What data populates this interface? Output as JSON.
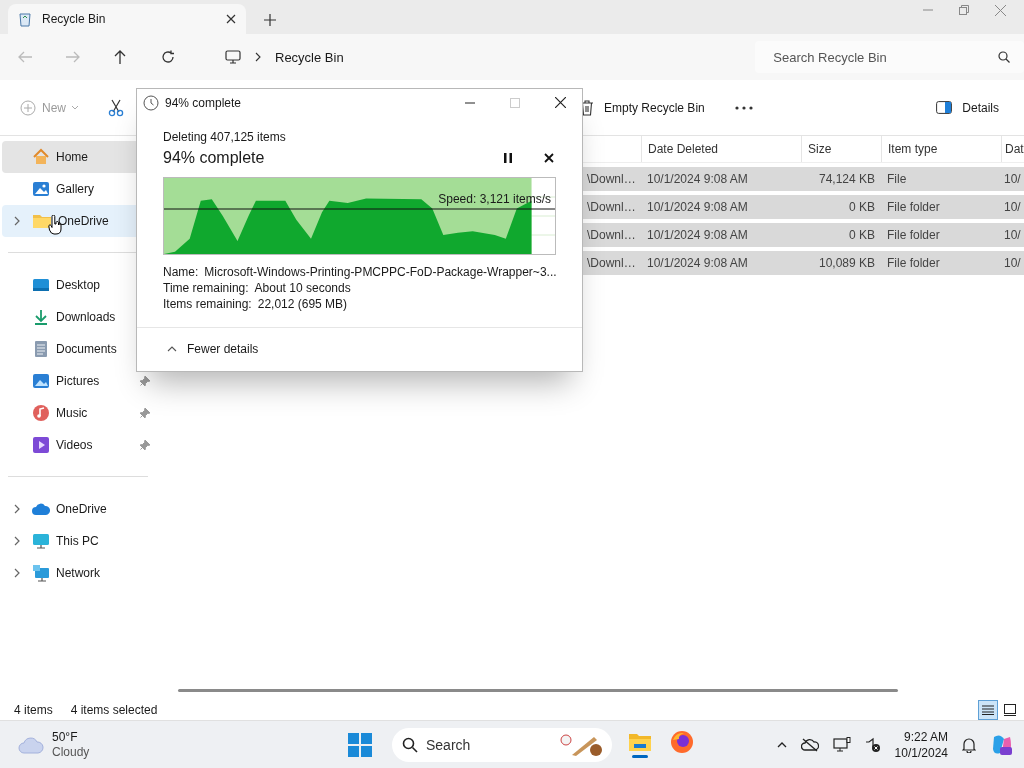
{
  "window": {
    "tab_title": "Recycle Bin"
  },
  "address": {
    "crumbs": [
      "Recycle Bin"
    ],
    "search": {
      "placeholder": "Search Recycle Bin"
    }
  },
  "toolbar": {
    "new": {
      "label": "New",
      "disabled": true
    },
    "empty_label": "Empty Recycle Bin",
    "details_label": "Details"
  },
  "sidebar": {
    "quick": [
      {
        "label": "Home",
        "selected": true,
        "hover": false,
        "expandable": false
      },
      {
        "label": "Gallery",
        "selected": false,
        "hover": false,
        "expandable": false
      },
      {
        "label": "OneDrive",
        "selected": false,
        "hover": true,
        "expandable": true
      }
    ],
    "pinned": [
      {
        "label": "Desktop"
      },
      {
        "label": "Downloads"
      },
      {
        "label": "Documents"
      },
      {
        "label": "Pictures",
        "pinned": true
      },
      {
        "label": "Music",
        "pinned": true
      },
      {
        "label": "Videos",
        "pinned": true
      }
    ],
    "tree": [
      {
        "label": "OneDrive"
      },
      {
        "label": "This PC"
      },
      {
        "label": "Network"
      }
    ]
  },
  "table": {
    "columns": [
      "",
      "Date Deleted",
      "Size",
      "Item type",
      "Dat"
    ],
    "rows": [
      {
        "selected": true,
        "cells": [
          "\\Downl…",
          "10/1/2024 9:08 AM",
          "74,124 KB",
          "File",
          "10/"
        ]
      },
      {
        "selected": true,
        "cells": [
          "\\Downl…",
          "10/1/2024 9:08 AM",
          "0 KB",
          "File folder",
          "10/"
        ]
      },
      {
        "selected": true,
        "cells": [
          "\\Downl…",
          "10/1/2024 9:08 AM",
          "0 KB",
          "File folder",
          "10/"
        ]
      },
      {
        "selected": true,
        "cells": [
          "\\Downl…",
          "10/1/2024 9:08 AM",
          "10,089 KB",
          "File folder",
          "10/"
        ]
      }
    ]
  },
  "status_bar": {
    "count": "4 items",
    "selection": "4 items selected",
    "views": [
      {
        "selected": true
      },
      {
        "selected": false
      }
    ]
  },
  "dialog": {
    "title": "94% complete",
    "summary": "Deleting 407,125 items",
    "heading": "94% complete",
    "graph": {
      "level": 0.94,
      "speed": "Speed: 3,121 items/s"
    },
    "details": [
      {
        "label": "Name:",
        "value": "Microsoft-Windows-Printing-PMCPPC-FoD-Package-Wrapper~3..."
      },
      {
        "label": "Time remaining:",
        "value": "About 10 seconds"
      },
      {
        "label": "Items remaining:",
        "value": "22,012 (695 MB)"
      }
    ],
    "toggle": "Fewer details"
  },
  "taskbar": {
    "weather": {
      "temperature": "50°F",
      "condition": "Cloudy"
    },
    "search": {
      "placeholder": "Search"
    },
    "apps": [
      {
        "selected": true
      },
      {
        "selected": false
      }
    ],
    "clock": {
      "time": "9:22 AM",
      "date": "10/1/2024"
    }
  }
}
